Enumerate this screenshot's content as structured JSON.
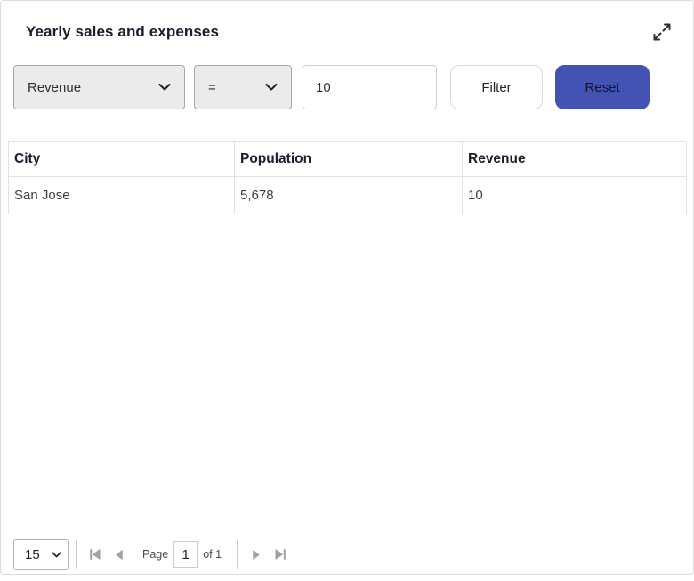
{
  "header": {
    "title": "Yearly sales and expenses"
  },
  "filters": {
    "field": "Revenue",
    "operator": "=",
    "value": "10",
    "filter_label": "Filter",
    "reset_label": "Reset"
  },
  "table": {
    "columns": [
      "City",
      "Population",
      "Revenue"
    ],
    "rows": [
      {
        "city": "San Jose",
        "population": "5,678",
        "revenue": "10"
      }
    ]
  },
  "pagination": {
    "page_size": "15",
    "page_label": "Page",
    "page_value": "1",
    "of_label": "of 1"
  },
  "colors": {
    "accent": "#4353b4",
    "select_bg": "#ebebeb",
    "border": "#e2e2e2"
  }
}
